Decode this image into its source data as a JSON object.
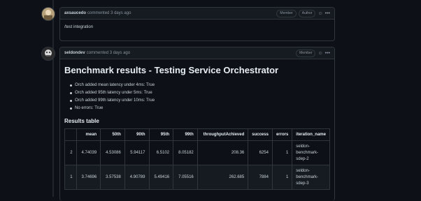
{
  "comments": [
    {
      "author": "axsaucedo",
      "action": "commented",
      "time": "3 days ago",
      "badges": [
        "Member",
        "Author"
      ],
      "body": "/test integration"
    },
    {
      "author": "seldondev",
      "action": "commented",
      "time": "3 days ago",
      "badges": [
        "Member"
      ],
      "title": "Benchmark results - Testing Service Orchestrator",
      "bullets": [
        "Orch added mean latency under 4ms: True",
        "Orch added 95th latency under 5ms: True",
        "Orch added 99th latency under 10ms: True",
        "No errors: True"
      ],
      "table_heading": "Results table",
      "table": {
        "headers": [
          "",
          "mean",
          "50th",
          "90th",
          "95th",
          "99th",
          "throughputAchieved",
          "success",
          "errors",
          "iteration_name"
        ],
        "rows": [
          [
            "2",
            "4.74039",
            "4.53086",
            "5.94117",
            "6.5102",
            "8.05182",
            "208.36",
            "6254",
            "1",
            "seldon-\nbenchmark-\nsdep-2"
          ],
          [
            "1",
            "3.74696",
            "3.57538",
            "4.90789",
            "5.49416",
            "7.05516",
            "262.685",
            "7884",
            "1",
            "seldon-\nbenchmark-\nsdep-3"
          ]
        ]
      }
    }
  ],
  "icons": {
    "smiley": "smiley-icon",
    "kebab": "kebab-menu-icon"
  },
  "colors": {
    "background": "#0d1117",
    "header": "#161b22",
    "border": "#30363d"
  }
}
